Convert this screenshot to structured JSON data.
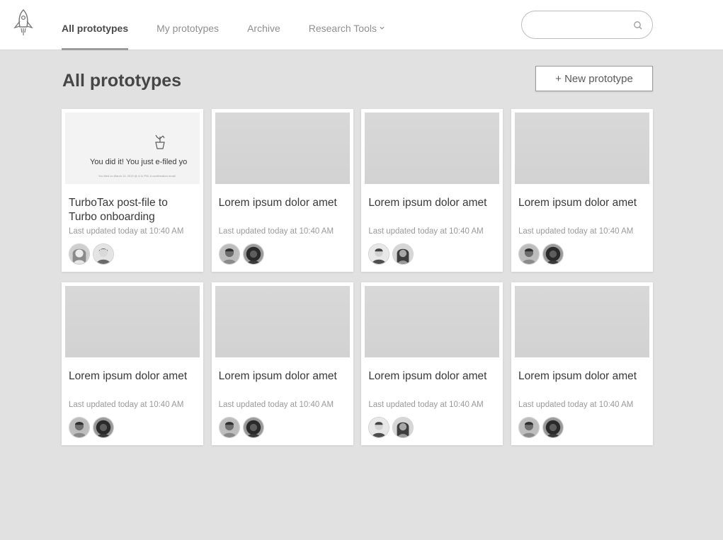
{
  "nav": {
    "items": [
      {
        "label": "All prototypes",
        "active": true
      },
      {
        "label": "My prototypes",
        "active": false
      },
      {
        "label": "Archive",
        "active": false
      },
      {
        "label": "Research Tools",
        "active": false,
        "dropdown": true
      }
    ]
  },
  "search": {
    "placeholder": "",
    "value": "",
    "icon": "search-icon"
  },
  "page": {
    "title": "All prototypes",
    "new_button_label": "+ New prototype"
  },
  "cards": [
    {
      "title": "TurboTax post-file to Turbo onboarding",
      "meta": "Last updated today at 10:40 AM",
      "preview": {
        "text": "You did it! You just e-filed yo",
        "subtext": "You filed on March 14, 2019 @ 4:11 PM. A confirmation email"
      },
      "avatars": [
        {
          "tone": "light",
          "hair": "long"
        },
        {
          "tone": "light",
          "hair": "short"
        }
      ]
    },
    {
      "title": "Lorem ipsum dolor amet",
      "meta": "Last updated today at 10:40 AM",
      "avatars": [
        {
          "tone": "mid",
          "hair": "short"
        },
        {
          "tone": "dark",
          "hair": "curly"
        }
      ]
    },
    {
      "title": "Lorem ipsum dolor amet",
      "meta": "Last updated today at 10:40 AM",
      "avatars": [
        {
          "tone": "light",
          "hair": "short"
        },
        {
          "tone": "mid",
          "hair": "long"
        }
      ]
    },
    {
      "title": "Lorem ipsum dolor amet",
      "meta": "Last updated today at 10:40 AM",
      "avatars": [
        {
          "tone": "mid",
          "hair": "short"
        },
        {
          "tone": "dark",
          "hair": "curly"
        }
      ]
    },
    {
      "title": "Lorem ipsum dolor amet",
      "meta": "Last updated today at 10:40 AM",
      "avatars": [
        {
          "tone": "mid",
          "hair": "short"
        },
        {
          "tone": "dark",
          "hair": "curly"
        }
      ]
    },
    {
      "title": "Lorem ipsum dolor amet",
      "meta": "Last updated today at 10:40 AM",
      "avatars": [
        {
          "tone": "mid",
          "hair": "short"
        },
        {
          "tone": "dark",
          "hair": "curly"
        }
      ]
    },
    {
      "title": "Lorem ipsum dolor amet",
      "meta": "Last updated today at 10:40 AM",
      "avatars": [
        {
          "tone": "light",
          "hair": "short"
        },
        {
          "tone": "mid",
          "hair": "long"
        }
      ]
    },
    {
      "title": "Lorem ipsum dolor amet",
      "meta": "Last updated today at 10:40 AM",
      "avatars": [
        {
          "tone": "mid",
          "hair": "short"
        },
        {
          "tone": "dark",
          "hair": "curly"
        }
      ]
    }
  ]
}
